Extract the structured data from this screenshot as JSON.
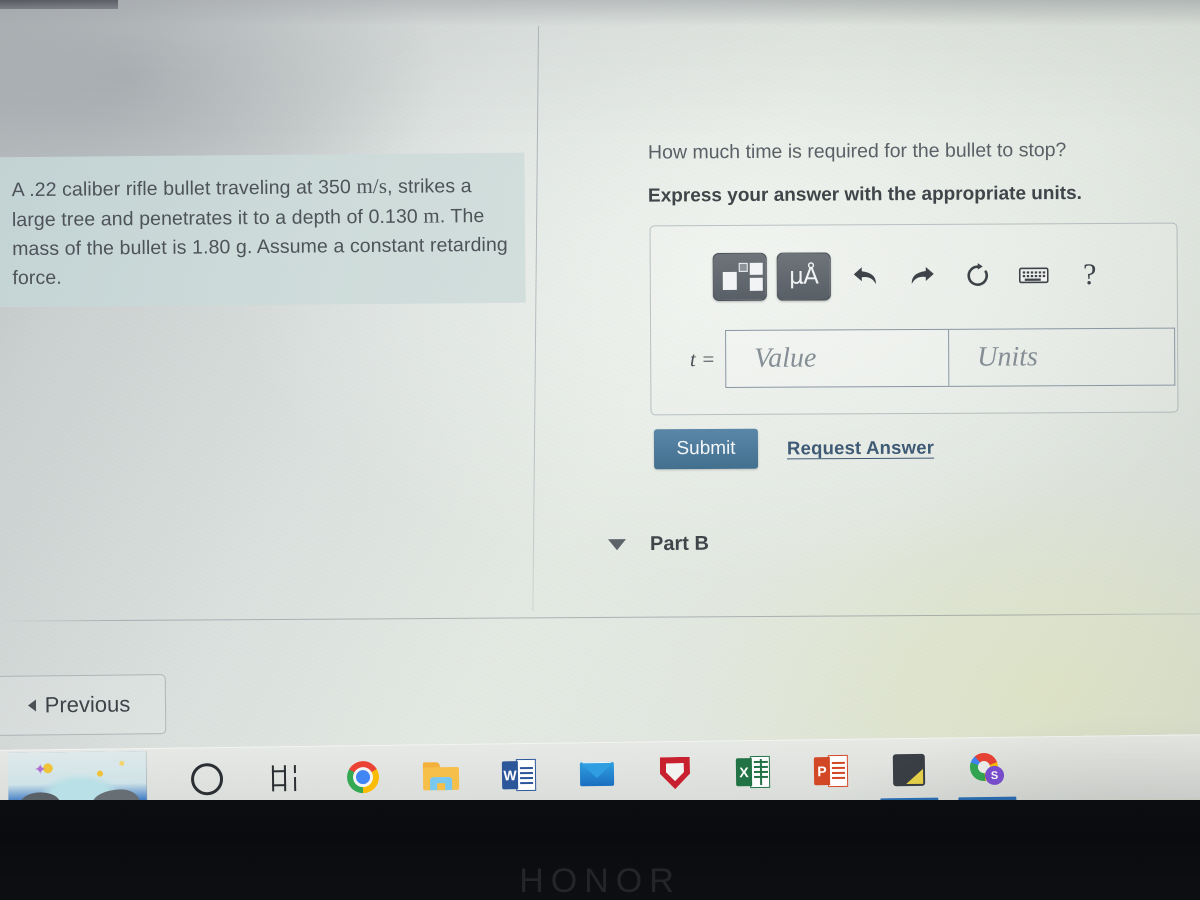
{
  "problem": {
    "text_line1": "A .22 caliber rifle bullet traveling at 350 ",
    "units_velocity": "m/s",
    "text_line2": ", strikes a large tree and penetrates it to a depth of 0.130 ",
    "units_depth": "m",
    "text_line3": ". The mass of the bullet is 1.80 g. Assume a constant retarding force.",
    "full_text": "A .22 caliber rifle bullet traveling at 350 m/s, strikes a large tree and penetrates it to a depth of 0.130 m. The mass of the bullet is 1.80 g. Assume a constant retarding force."
  },
  "question": {
    "prompt": "How much time is required for the bullet to stop?",
    "instruction": "Express your answer with the appropriate units."
  },
  "answer_widget": {
    "toolbar": {
      "template_icon": "math-template-icon",
      "units_label": "μÅ",
      "undo_icon": "undo-arrow-icon",
      "redo_icon": "redo-arrow-icon",
      "reset_icon": "reset-circular-arrow-icon",
      "keyboard_icon": "keyboard-icon",
      "help_label": "?"
    },
    "variable_label": "t =",
    "value_placeholder": "Value",
    "value_current": "",
    "units_placeholder": "Units",
    "units_current": ""
  },
  "actions": {
    "submit_label": "Submit",
    "request_answer_label": "Request Answer",
    "previous_label": "Previous",
    "previous_caret": "◂"
  },
  "parts": {
    "caret": "▼",
    "part_b_label": "Part B"
  },
  "taskbar": {
    "items": [
      {
        "name": "start-wallpaper-tile",
        "label": ""
      },
      {
        "name": "cortana-search-icon",
        "label": ""
      },
      {
        "name": "task-view-icon",
        "label": ""
      },
      {
        "name": "google-chrome-icon",
        "label": ""
      },
      {
        "name": "file-explorer-icon",
        "label": ""
      },
      {
        "name": "microsoft-word-icon",
        "label": "W"
      },
      {
        "name": "mail-icon",
        "label": ""
      },
      {
        "name": "mcafee-icon",
        "label": ""
      },
      {
        "name": "microsoft-excel-icon",
        "label": "X"
      },
      {
        "name": "microsoft-powerpoint-icon",
        "label": "P"
      },
      {
        "name": "sticky-note-app-icon",
        "label": ""
      },
      {
        "name": "google-app-icon",
        "label": "S"
      }
    ]
  },
  "device": {
    "brand_logo": "HONOR"
  },
  "colors": {
    "submit_blue": "#4a7fa5",
    "link_blue": "#3f5a75",
    "problem_box_bg": "#c8d9d8",
    "text_gray": "#4d5358",
    "toolbar_button_dark": "#626970"
  }
}
